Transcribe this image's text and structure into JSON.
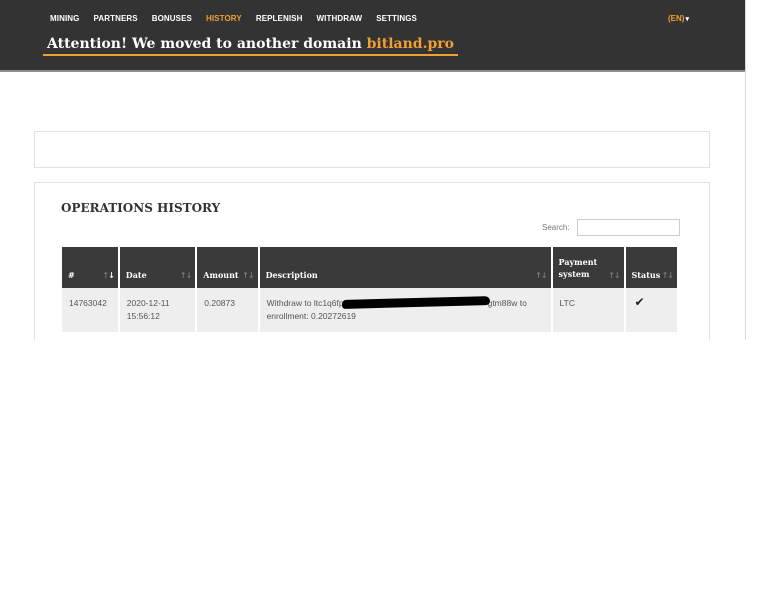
{
  "nav": {
    "items": [
      {
        "label": "MINING"
      },
      {
        "label": "PARTNERS"
      },
      {
        "label": "BONUSES"
      },
      {
        "label": "HISTORY"
      },
      {
        "label": "REPLENISH"
      },
      {
        "label": "WITHDRAW"
      },
      {
        "label": "SETTINGS"
      }
    ],
    "active_item": "HISTORY",
    "language": "(EN)",
    "accent_color": "#f0a030",
    "background_color": "#333333"
  },
  "banner": {
    "text": "Attention! We moved to another domain",
    "domain": "bitland.pro"
  },
  "history": {
    "title": "OPERATIONS HISTORY",
    "search_label": "Search:",
    "search_value": "",
    "columns": [
      "#",
      "Date",
      "Amount",
      "Description",
      "Payment system",
      "Status"
    ],
    "rows": [
      {
        "id": "14763042",
        "date": "2020-12-11",
        "time": "15:56:12",
        "amount": "0.20873",
        "description_prefix": "Withdraw to ltc1q6fp",
        "description_suffix": "gtm88w to",
        "description_line2": "enrollment: 0.20272619",
        "payment_system": "LTC",
        "status_icon": "checkmark-icon"
      }
    ]
  }
}
